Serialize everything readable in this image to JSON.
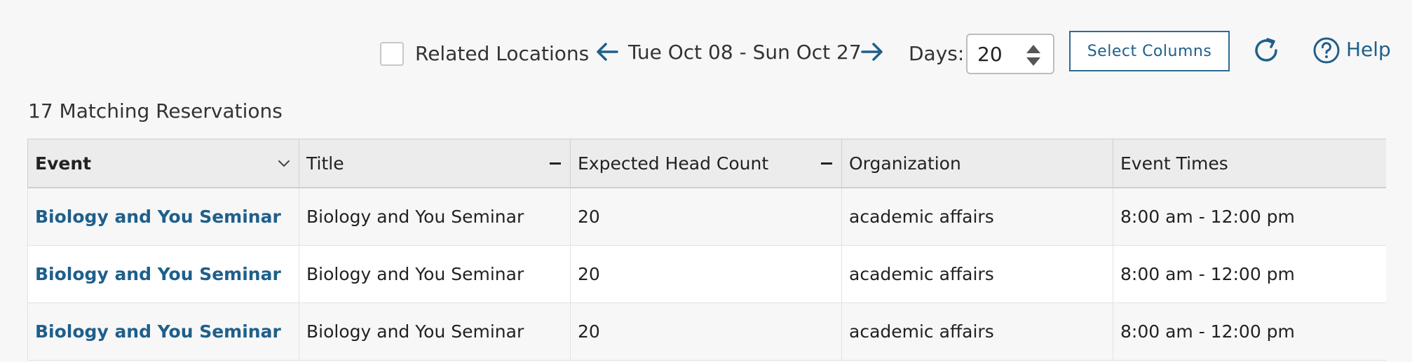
{
  "toolbar": {
    "related_locations_label": "Related Locations",
    "related_locations_checked": false,
    "date_range": "Tue Oct 08 - Sun Oct 27",
    "days_label": "Days:",
    "days_value": "20",
    "select_columns_label": "Select Columns",
    "help_label": "Help",
    "icons": {
      "prev": "arrow-left-icon",
      "next": "arrow-right-icon",
      "refresh": "refresh-icon",
      "help": "help-circle-icon"
    }
  },
  "results": {
    "count_text": "17 Matching Reservations"
  },
  "table": {
    "headers": [
      "Event",
      "Title",
      "Expected Head Count",
      "Organization",
      "Event Times"
    ],
    "rows": [
      {
        "event": "Biology and You Seminar",
        "title": "Biology and You Seminar",
        "head_count": "20",
        "organization": "academic affairs",
        "times": "8:00 am - 12:00 pm"
      },
      {
        "event": "Biology and You Seminar",
        "title": "Biology and You Seminar",
        "head_count": "20",
        "organization": "academic affairs",
        "times": "8:00 am - 12:00 pm"
      },
      {
        "event": "Biology and You Seminar",
        "title": "Biology and You Seminar",
        "head_count": "20",
        "organization": "academic affairs",
        "times": "8:00 am - 12:00 pm"
      }
    ]
  },
  "colors": {
    "accent": "#1f5f8b",
    "background": "#f7f7f7",
    "header_background": "#ececec"
  }
}
